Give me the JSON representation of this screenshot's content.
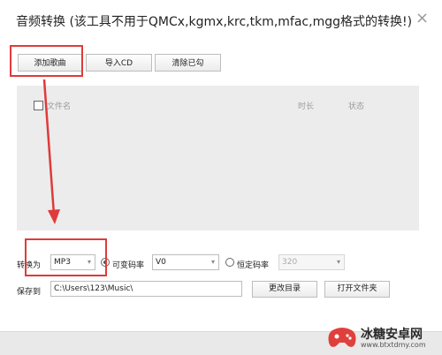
{
  "dialog": {
    "title": "音频转换 (该工具不用于QMCx,kgmx,krc,tkm,mfac,mgg格式的转换!)",
    "close_symbol": "×"
  },
  "toolbar": {
    "add_song": "添加歌曲",
    "import_cd": "导入CD",
    "clear_checked": "清除已勾"
  },
  "table": {
    "columns": {
      "filename": "文件名",
      "duration": "时长",
      "status": "状态"
    }
  },
  "convert": {
    "label": "转换为",
    "format_selected": "MP3",
    "vbr_label": "可变码率",
    "vbr_selected": "V0",
    "cbr_label": "恒定码率",
    "cbr_selected": "320",
    "vbr_checked": true
  },
  "save": {
    "label": "保存到",
    "path": "C:\\Users\\123\\Music\\",
    "change_dir": "更改目录",
    "open_folder": "打开文件夹"
  },
  "watermark": {
    "name": "冰糖安卓网",
    "url": "www.btxtdmy.com"
  },
  "colors": {
    "highlight": "#e03a3a",
    "list_bg": "#ececec"
  }
}
